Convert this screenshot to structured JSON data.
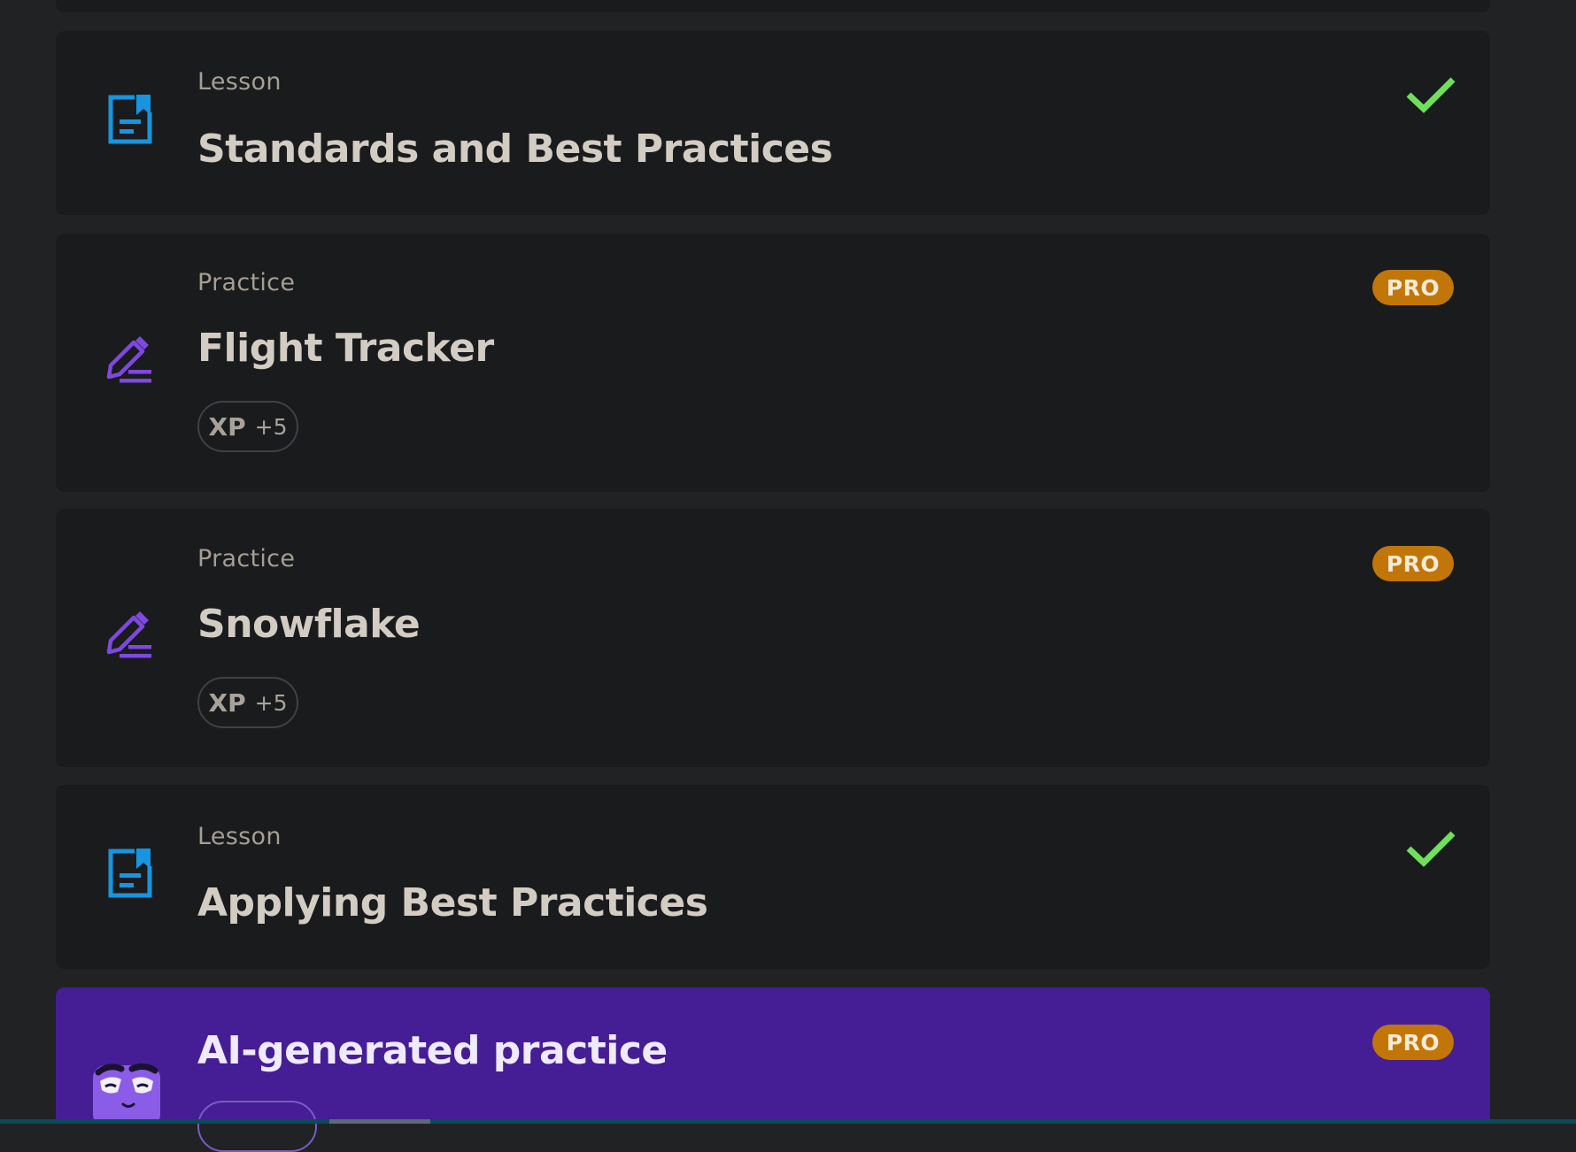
{
  "items": [
    {
      "kind": "Lesson",
      "title": "Standards and Best Practices",
      "status_icon": "check-icon",
      "type_icon": "document-icon"
    },
    {
      "kind": "Practice",
      "title": "Flight Tracker",
      "badge": "PRO",
      "xp_label": "XP",
      "xp_value": "+5",
      "type_icon": "pencil-icon"
    },
    {
      "kind": "Practice",
      "title": "Snowflake",
      "badge": "PRO",
      "xp_label": "XP",
      "xp_value": "+5",
      "type_icon": "pencil-icon"
    },
    {
      "kind": "Lesson",
      "title": "Applying Best Practices",
      "status_icon": "check-icon",
      "type_icon": "document-icon"
    },
    {
      "title": "AI-generated practice",
      "badge": "PRO",
      "type_icon": "mascot-icon"
    }
  ],
  "colors": {
    "page_bg": "#202224",
    "card_bg": "#1a1b1d",
    "ai_card_bg": "#451e95",
    "lesson_icon": "#1795e0",
    "practice_icon": "#7f48e0",
    "check": "#6fe05a",
    "pro_badge": "#c27608",
    "title_text": "#d2ccc3",
    "kind_text": "#a49e94"
  }
}
